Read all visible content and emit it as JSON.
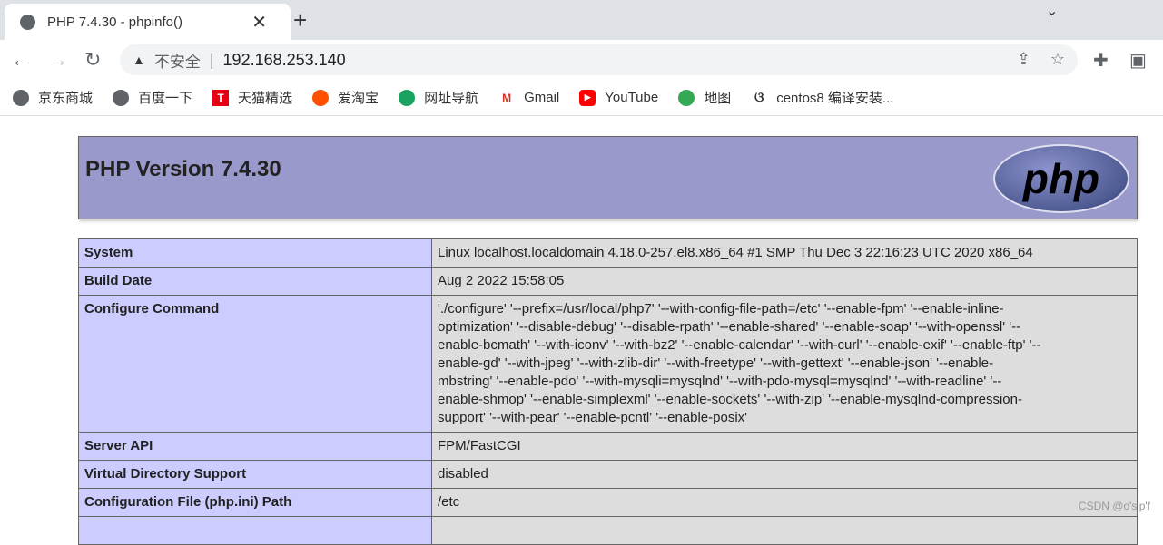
{
  "browser": {
    "tab_title": "PHP 7.4.30 - phpinfo()",
    "insecure_label": "不安全",
    "url": "192.168.253.140",
    "bookmarks": [
      {
        "label": "京东商城",
        "icon": "globe-icon",
        "color": "#5f6368"
      },
      {
        "label": "百度一下",
        "icon": "globe-icon",
        "color": "#5f6368"
      },
      {
        "label": "天猫精选",
        "icon": "tmall-icon",
        "color": "#e60012"
      },
      {
        "label": "爱淘宝",
        "icon": "taobao-icon",
        "color": "#ff5000"
      },
      {
        "label": "网址导航",
        "icon": "nav-icon",
        "color": "#1aa260"
      },
      {
        "label": "Gmail",
        "icon": "gmail-icon",
        "color": "#d93025"
      },
      {
        "label": "YouTube",
        "icon": "youtube-icon",
        "color": "#ff0000"
      },
      {
        "label": "地图",
        "icon": "maps-icon",
        "color": "#34a853"
      },
      {
        "label": "centos8 编译安装...",
        "icon": "page-icon",
        "color": "#333333"
      }
    ]
  },
  "page": {
    "title": "PHP Version 7.4.30",
    "logo_text": "php",
    "rows": [
      {
        "key": "System",
        "value": [
          "Linux localhost.localdomain 4.18.0-257.el8.x86_64 #1 SMP Thu Dec 3 22:16:23 UTC 2020 x86_64"
        ]
      },
      {
        "key": "Build Date",
        "value": [
          "Aug 2 2022 15:58:05"
        ]
      },
      {
        "key": "Configure Command",
        "value": [
          "'./configure' '--prefix=/usr/local/php7' '--with-config-file-path=/etc' '--enable-fpm' '--enable-inline-",
          "optimization' '--disable-debug' '--disable-rpath' '--enable-shared' '--enable-soap' '--with-openssl' '--",
          "enable-bcmath' '--with-iconv' '--with-bz2' '--enable-calendar' '--with-curl' '--enable-exif' '--enable-ftp' '--",
          "enable-gd' '--with-jpeg' '--with-zlib-dir' '--with-freetype' '--with-gettext' '--enable-json' '--enable-",
          "mbstring' '--enable-pdo' '--with-mysqli=mysqlnd' '--with-pdo-mysql=mysqlnd' '--with-readline' '--",
          "enable-shmop' '--enable-simplexml' '--enable-sockets' '--with-zip' '--enable-mysqlnd-compression-",
          "support' '--with-pear' '--enable-pcntl' '--enable-posix'"
        ]
      },
      {
        "key": "Server API",
        "value": [
          "FPM/FastCGI"
        ]
      },
      {
        "key": "Virtual Directory Support",
        "value": [
          "disabled"
        ]
      },
      {
        "key": "Configuration File (php.ini) Path",
        "value": [
          "/etc"
        ]
      },
      {
        "key": "",
        "value": [
          ""
        ]
      }
    ]
  },
  "watermark": "CSDN @o's'p'f"
}
